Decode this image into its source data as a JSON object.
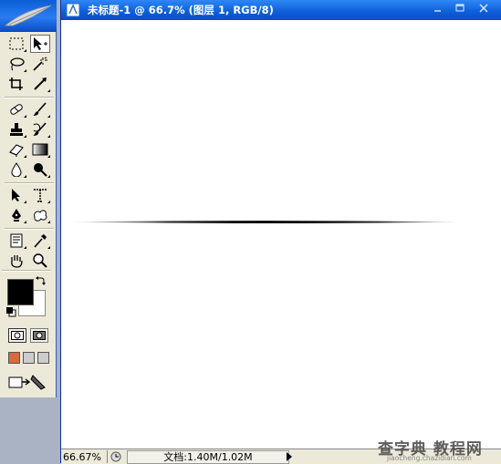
{
  "document": {
    "title": "未标题-1 @ 66.7% (图层 1, RGB/8)",
    "zoom": "66.67%",
    "doc_size": "文档:1.40M/1.02M"
  },
  "toolbox": {
    "icons": [
      "feather-icon"
    ],
    "foreground_color": "#000000",
    "background_color": "#ffffff"
  },
  "canvas": {
    "stroke_color": "#000000",
    "background": "#ffffff"
  },
  "watermark": {
    "main": "查字典 教程网",
    "sub": "jiaocheng.chazidian.com"
  },
  "colors": {
    "titlebar": "#0c5ed8",
    "toolbox_bg": "#ece9d8",
    "desktop": "#a9b3c4"
  }
}
